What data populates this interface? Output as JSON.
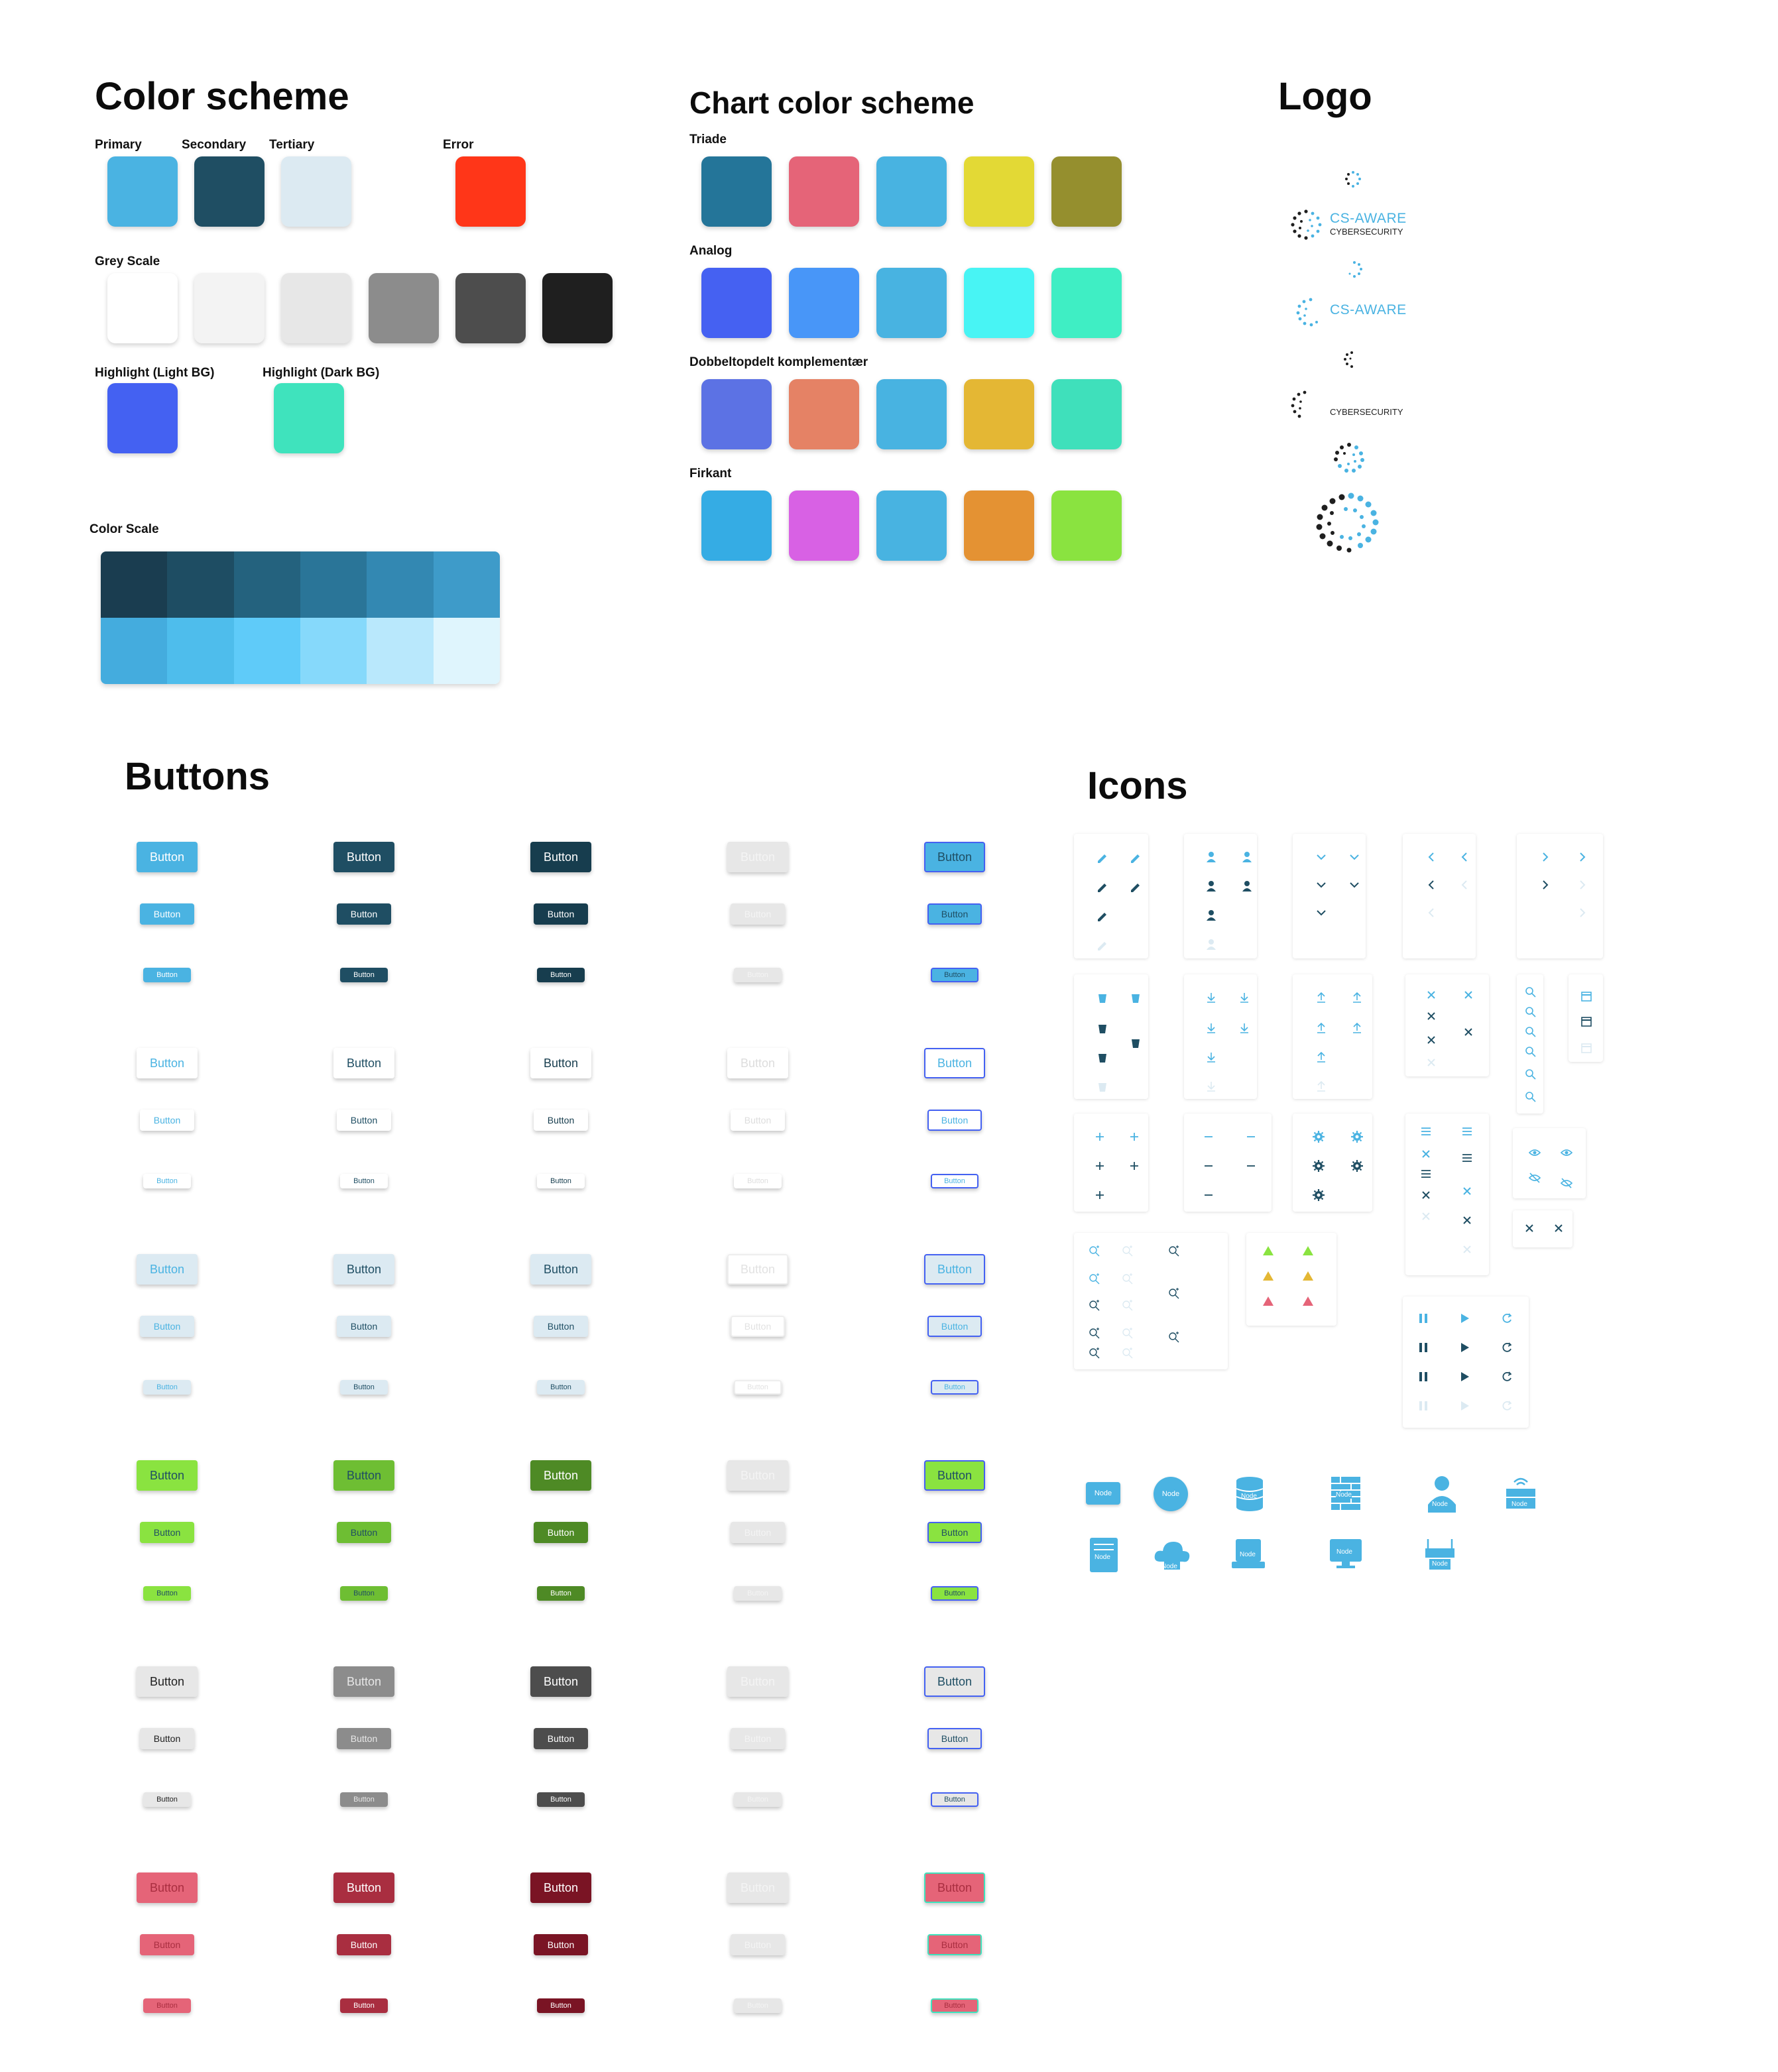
{
  "headings": {
    "color_scheme": "Color scheme",
    "chart_color_scheme": "Chart color scheme",
    "logo": "Logo",
    "buttons": "Buttons",
    "icons": "Icons"
  },
  "color_scheme": {
    "labels": {
      "primary": "Primary",
      "secondary": "Secondary",
      "tertiary": "Tertiary",
      "error": "Error",
      "grey_scale": "Grey Scale",
      "highlight_light": "Highlight (Light BG)",
      "highlight_dark": "Highlight (Dark BG)",
      "color_scale": "Color Scale"
    },
    "colors": {
      "primary": "#4AB3E2",
      "secondary": "#1F4E63",
      "tertiary": "#DCEAF2",
      "error": "#FF3618",
      "highlight_light": "#4461F2",
      "highlight_dark": "#3FE3BD"
    },
    "grey_scale": [
      "#FFFFFF",
      "#F3F3F3",
      "#E7E7E7",
      "#8C8C8C",
      "#4D4D4D",
      "#1F1F1F"
    ],
    "color_scale": [
      "#1A3D50",
      "#1E4D63",
      "#24627E",
      "#2A7598",
      "#3388B2",
      "#3E9BC9",
      "#44ACDE",
      "#4EBDEC",
      "#5FCBF9",
      "#86D9FB",
      "#B9E8FC",
      "#DFF5FD"
    ]
  },
  "chart_color_scheme": {
    "groups": [
      {
        "label": "Triade",
        "colors": [
          "#247599",
          "#E56478",
          "#48B3E1",
          "#E3D935",
          "#958F2E"
        ]
      },
      {
        "label": "Analog",
        "colors": [
          "#4561F2",
          "#4896F8",
          "#48B3E1",
          "#48F4F4",
          "#3FEEC4"
        ]
      },
      {
        "label": "Dobbeltopdelt komplementær",
        "colors": [
          "#5C72E4",
          "#E58265",
          "#48B3E1",
          "#E4B734",
          "#3FE0BB"
        ]
      },
      {
        "label": "Firkant",
        "colors": [
          "#35ACE4",
          "#D861E4",
          "#48B3E1",
          "#E49233",
          "#8AE340"
        ]
      }
    ]
  },
  "logo": {
    "name": "CS-AWARE",
    "tagline": "CYBERSECURITY"
  },
  "buttons": {
    "label": "Button",
    "rows": [
      {
        "bg": [
          "#4AB3E2",
          "#1F4E63",
          "#173D4E",
          "#E7E7E7",
          "#4AB3E2"
        ],
        "fg": [
          "#FFFFFF",
          "#FFFFFF",
          "#FFFFFF",
          "#F4F4F4",
          "#1F4E63"
        ],
        "border": [
          "none",
          "none",
          "none",
          "none",
          "2px solid #4461F2"
        ]
      },
      {
        "bg": [
          "#FFFFFF",
          "#FFFFFF",
          "#FFFFFF",
          "#FFFFFF",
          "#FFFFFF"
        ],
        "fg": [
          "#4AB3E2",
          "#1F4E63",
          "#173D4E",
          "#DDDDDD",
          "#4AB3E2"
        ],
        "border": [
          "none",
          "none",
          "none",
          "none",
          "2px solid #4461F2"
        ]
      },
      {
        "bg": [
          "#DCEAF2",
          "#DCEAF2",
          "#DCEAF2",
          "#FFFFFF",
          "#DCEAF2"
        ],
        "fg": [
          "#4AB3E2",
          "#1F4E63",
          "#1F4E63",
          "#E2E2E2",
          "#4AB3E2"
        ],
        "border": [
          "none",
          "none",
          "none",
          "2px solid #EEEEEE",
          "2px solid #4461F2"
        ]
      },
      {
        "bg": [
          "#8AE340",
          "#6EBE33",
          "#4E8A25",
          "#E7E7E7",
          "#8AE340"
        ],
        "fg": [
          "#1F4E63",
          "#1F4E63",
          "#FFFFFF",
          "#F4F4F4",
          "#1F4E63"
        ],
        "border": [
          "none",
          "none",
          "none",
          "none",
          "2px solid #4461F2"
        ]
      },
      {
        "bg": [
          "#E7E7E7",
          "#8C8C8C",
          "#4D4D4D",
          "#E7E7E7",
          "#E7E7E7"
        ],
        "fg": [
          "#1F1F1F",
          "#E7E7E7",
          "#FFFFFF",
          "#F4F4F4",
          "#1F4E63"
        ],
        "border": [
          "none",
          "none",
          "none",
          "none",
          "2px solid #4461F2"
        ]
      },
      {
        "bg": [
          "#E56478",
          "#A92E40",
          "#7A1424",
          "#E7E7E7",
          "#E56478"
        ],
        "fg": [
          "#A92E40",
          "#FFFFFF",
          "#FFFFFF",
          "#F4F4F4",
          "#A92E40"
        ],
        "border": [
          "none",
          "none",
          "none",
          "none",
          "2px solid #3FE3BD"
        ]
      }
    ]
  },
  "icons": {
    "node_label": "Node",
    "colors": {
      "light": "#4AB3E2",
      "dark": "#1F4E63",
      "faint": "#DCEAF2",
      "warn_green": "#8AE340",
      "warn_yellow": "#E4B734",
      "warn_red": "#E56478"
    }
  }
}
